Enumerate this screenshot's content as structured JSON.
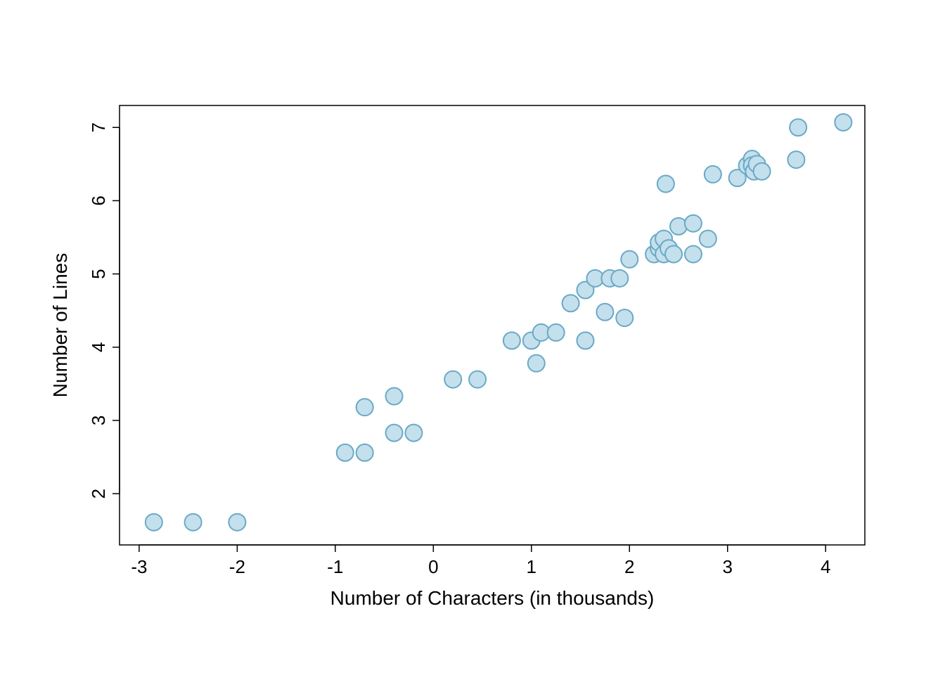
{
  "chart_data": {
    "type": "scatter",
    "xlabel": "Number of Characters (in thousands)",
    "ylabel": "Number of Lines",
    "title": "",
    "xlim": [
      -3.2,
      4.4
    ],
    "ylim": [
      1.3,
      7.3
    ],
    "x_ticks": [
      -3,
      -2,
      -1,
      0,
      1,
      2,
      3,
      4
    ],
    "y_ticks": [
      2,
      3,
      4,
      5,
      6,
      7
    ],
    "points": [
      {
        "x": -2.85,
        "y": 1.61
      },
      {
        "x": -2.45,
        "y": 1.61
      },
      {
        "x": -2.0,
        "y": 1.61
      },
      {
        "x": -0.9,
        "y": 2.56
      },
      {
        "x": -0.7,
        "y": 2.56
      },
      {
        "x": -0.7,
        "y": 3.18
      },
      {
        "x": -0.4,
        "y": 2.83
      },
      {
        "x": -0.4,
        "y": 3.33
      },
      {
        "x": -0.2,
        "y": 2.83
      },
      {
        "x": 0.2,
        "y": 3.56
      },
      {
        "x": 0.45,
        "y": 3.56
      },
      {
        "x": 0.8,
        "y": 4.09
      },
      {
        "x": 1.0,
        "y": 4.09
      },
      {
        "x": 1.05,
        "y": 3.78
      },
      {
        "x": 1.1,
        "y": 4.2
      },
      {
        "x": 1.25,
        "y": 4.2
      },
      {
        "x": 1.4,
        "y": 4.6
      },
      {
        "x": 1.55,
        "y": 4.09
      },
      {
        "x": 1.55,
        "y": 4.78
      },
      {
        "x": 1.65,
        "y": 4.94
      },
      {
        "x": 1.75,
        "y": 4.48
      },
      {
        "x": 1.8,
        "y": 4.94
      },
      {
        "x": 1.9,
        "y": 4.94
      },
      {
        "x": 1.95,
        "y": 4.4
      },
      {
        "x": 2.0,
        "y": 5.2
      },
      {
        "x": 2.25,
        "y": 5.27
      },
      {
        "x": 2.3,
        "y": 5.35
      },
      {
        "x": 2.3,
        "y": 5.43
      },
      {
        "x": 2.35,
        "y": 5.27
      },
      {
        "x": 2.35,
        "y": 5.48
      },
      {
        "x": 2.37,
        "y": 6.23
      },
      {
        "x": 2.4,
        "y": 5.35
      },
      {
        "x": 2.45,
        "y": 5.27
      },
      {
        "x": 2.5,
        "y": 5.65
      },
      {
        "x": 2.65,
        "y": 5.27
      },
      {
        "x": 2.65,
        "y": 5.69
      },
      {
        "x": 2.8,
        "y": 5.48
      },
      {
        "x": 2.85,
        "y": 6.36
      },
      {
        "x": 3.1,
        "y": 6.31
      },
      {
        "x": 3.2,
        "y": 6.48
      },
      {
        "x": 3.25,
        "y": 6.57
      },
      {
        "x": 3.25,
        "y": 6.48
      },
      {
        "x": 3.27,
        "y": 6.4
      },
      {
        "x": 3.3,
        "y": 6.5
      },
      {
        "x": 3.35,
        "y": 6.4
      },
      {
        "x": 3.7,
        "y": 6.56
      },
      {
        "x": 3.72,
        "y": 7.0
      },
      {
        "x": 4.18,
        "y": 7.07
      }
    ],
    "marker_color_fill": "#c4e0ec",
    "marker_color_stroke": "#6aa9c6"
  }
}
